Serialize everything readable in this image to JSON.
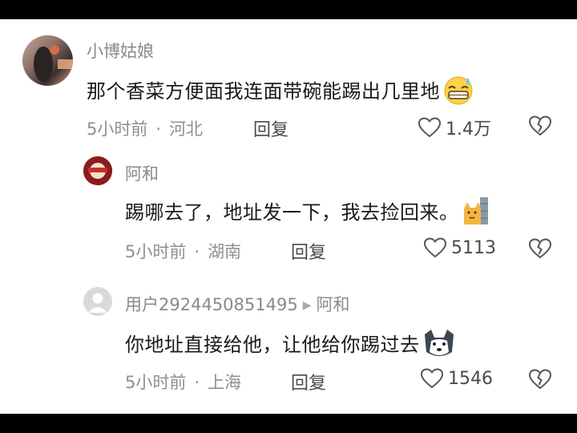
{
  "comments": [
    {
      "username": "小博姑娘",
      "text": "那个香菜方便面我连面带碗能踢出几里地",
      "emoji": "sweat-grin-emoji",
      "time": "5小时前",
      "location": "河北",
      "reply_label": "回复",
      "likes": "1.4万"
    },
    {
      "username": "阿和",
      "text": "踢哪去了，地址发一下，我去捡回来。",
      "emoji": "cat-wall-emoji",
      "time": "5小时前",
      "location": "湖南",
      "reply_label": "回复",
      "likes": "5113"
    },
    {
      "username": "用户2924450851495",
      "reply_to": "阿和",
      "text": "你地址直接给他，让他给你踢过去",
      "emoji": "husky-emoji",
      "time": "5小时前",
      "location": "上海",
      "reply_label": "回复",
      "likes": "1546"
    }
  ]
}
